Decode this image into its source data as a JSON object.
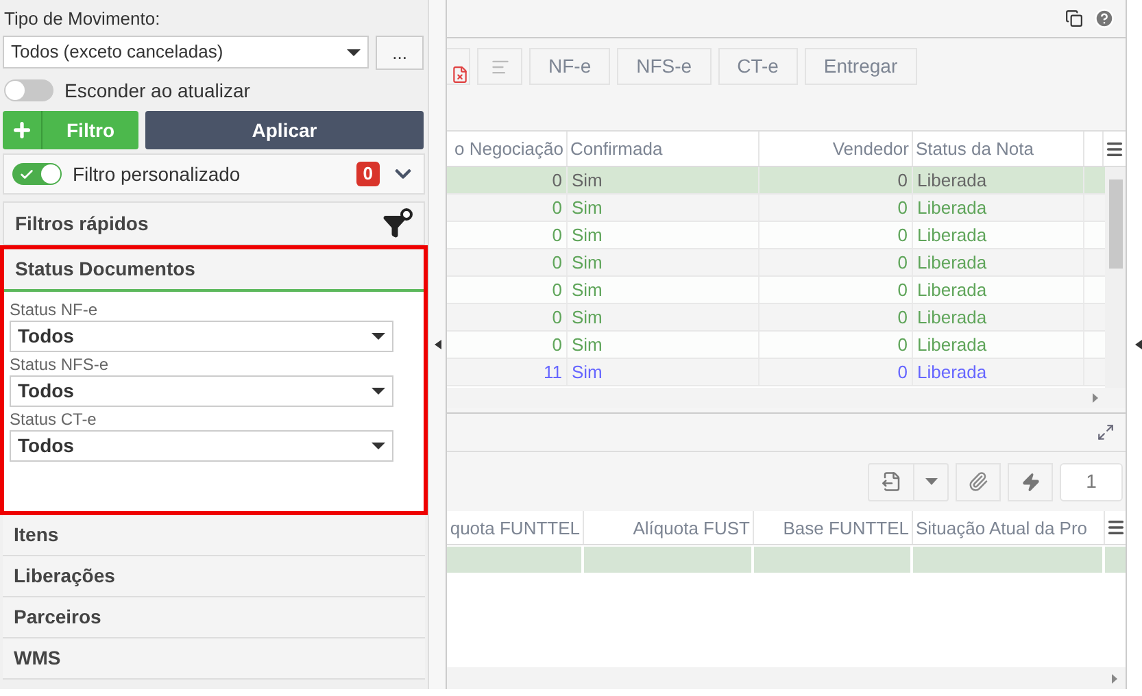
{
  "filter_panel": {
    "movement_type": {
      "label": "Tipo de Movimento:",
      "value": "Todos (exceto canceladas)",
      "more_button": "..."
    },
    "hide_on_update": {
      "label": "Esconder ao atualizar",
      "on": false
    },
    "add_filter_button": "Filtro",
    "apply_button": "Aplicar",
    "custom_filter": {
      "label": "Filtro personalizado",
      "on": true,
      "count": "0"
    },
    "quick_filters": {
      "title": "Filtros rápidos"
    },
    "status_section": {
      "title": "Status Documentos",
      "highlighted": true,
      "fields": [
        {
          "label": "Status NF-e",
          "value": "Todos"
        },
        {
          "label": "Status NFS-e",
          "value": "Todos"
        },
        {
          "label": "Status CT-e",
          "value": "Todos"
        }
      ]
    },
    "sections": [
      {
        "title": "Itens"
      },
      {
        "title": "Liberações"
      },
      {
        "title": "Parceiros"
      },
      {
        "title": "WMS"
      }
    ]
  },
  "top_grid": {
    "buttons": [
      "NF-e",
      "NFS-e",
      "CT-e",
      "Entregar"
    ],
    "columns": [
      "o Negociação",
      "Confirmada",
      "Vendedor",
      "Status da Nota"
    ],
    "rows": [
      {
        "selected": true,
        "color": "#666666",
        "cells": [
          "0",
          "Sim",
          "0",
          "Liberada"
        ]
      },
      {
        "selected": false,
        "color": "#5fa55a",
        "cells": [
          "0",
          "Sim",
          "0",
          "Liberada"
        ]
      },
      {
        "selected": false,
        "color": "#5fa55a",
        "cells": [
          "0",
          "Sim",
          "0",
          "Liberada"
        ]
      },
      {
        "selected": false,
        "color": "#5fa55a",
        "cells": [
          "0",
          "Sim",
          "0",
          "Liberada"
        ]
      },
      {
        "selected": false,
        "color": "#5fa55a",
        "cells": [
          "0",
          "Sim",
          "0",
          "Liberada"
        ]
      },
      {
        "selected": false,
        "color": "#5fa55a",
        "cells": [
          "0",
          "Sim",
          "0",
          "Liberada"
        ]
      },
      {
        "selected": false,
        "color": "#5fa55a",
        "cells": [
          "0",
          "Sim",
          "0",
          "Liberada"
        ]
      },
      {
        "selected": false,
        "color": "#6666ff",
        "cells": [
          "11",
          "Sim",
          "0",
          "Liberada"
        ]
      }
    ]
  },
  "bottom_grid": {
    "page": "1",
    "columns": [
      "quota FUNTTEL",
      "Alíquota FUST",
      "Base FUNTTEL",
      "Situação Atual da Pro"
    ],
    "rows": [
      {
        "selected": true
      }
    ]
  }
}
